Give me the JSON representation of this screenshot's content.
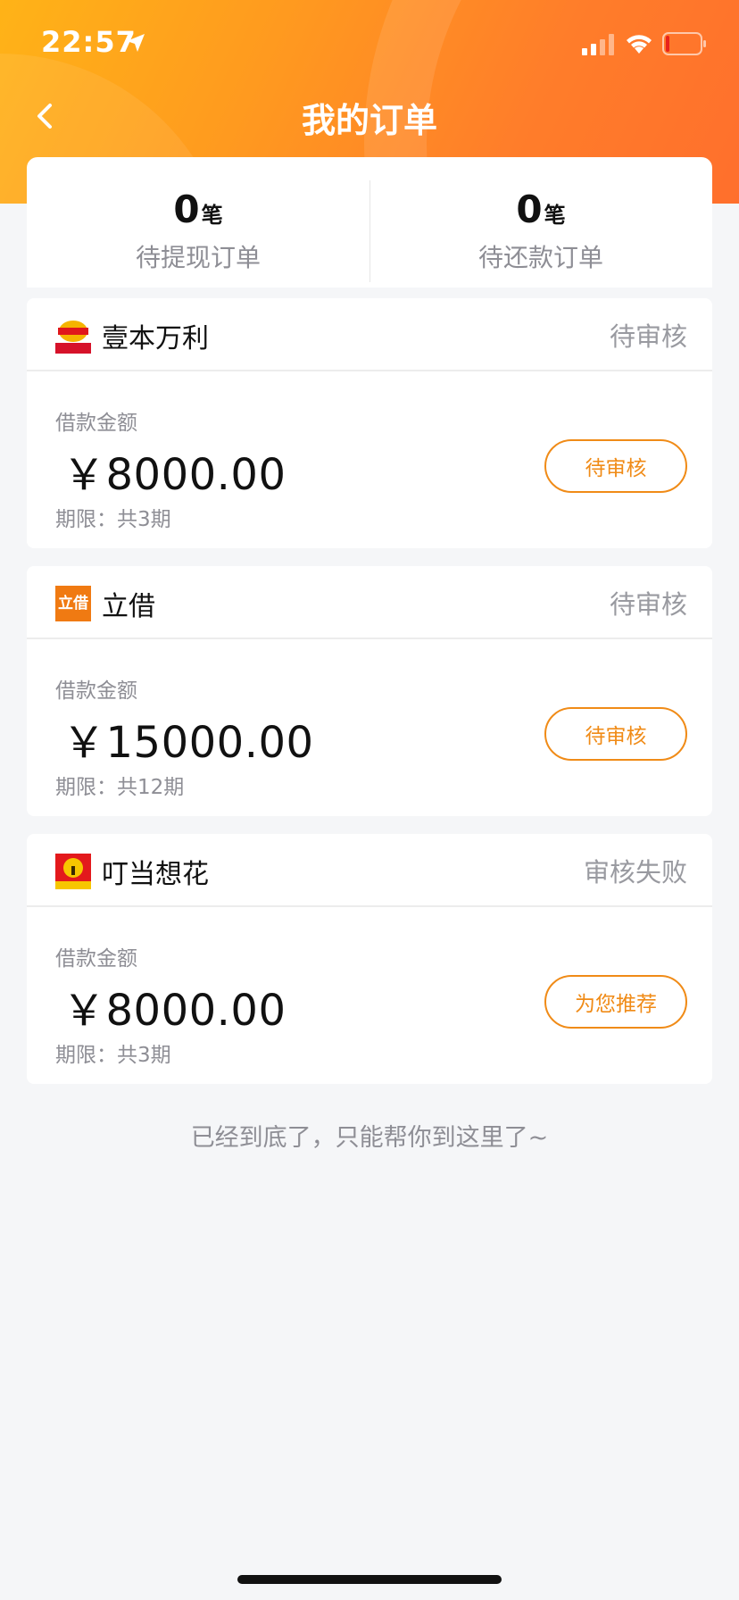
{
  "status_bar": {
    "time": "22:57"
  },
  "nav": {
    "title": "我的订单"
  },
  "summary": [
    {
      "count": "0",
      "unit": "笔",
      "label": "待提现订单"
    },
    {
      "count": "0",
      "unit": "笔",
      "label": "待还款订单"
    }
  ],
  "orders": [
    {
      "brand": "壹本万利",
      "status": "待审核",
      "amount_label": "借款金额",
      "amount": "￥8000.00",
      "term": "期限：共3期",
      "action": "待审核"
    },
    {
      "brand": "立借",
      "logo_text": "立借",
      "status": "待审核",
      "amount_label": "借款金额",
      "amount": "￥15000.00",
      "term": "期限：共12期",
      "action": "待审核"
    },
    {
      "brand": "叮当想花",
      "status": "审核失败",
      "amount_label": "借款金额",
      "amount": "￥8000.00",
      "term": "期限：共3期",
      "action": "为您推荐"
    }
  ],
  "footer": {
    "note": "已经到底了，只能帮你到这里了~"
  },
  "colors": {
    "accent": "#f08b17",
    "header_start": "#ffb317",
    "header_end": "#ff6f2c"
  },
  "icons": [
    "location-arrow-icon",
    "cellular-signal-icon",
    "wifi-icon",
    "battery-icon",
    "back-chevron-icon"
  ]
}
